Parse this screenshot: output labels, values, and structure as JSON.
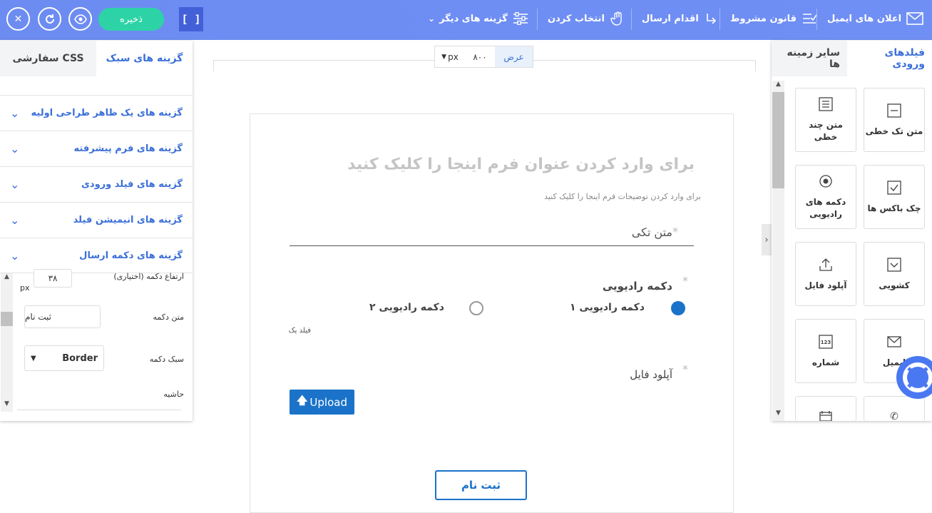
{
  "topbar": {
    "save_label": "ذخیره",
    "bracket_label": "[ ]",
    "items": [
      {
        "label": "اعلان های ایمیل",
        "icon": "mail-icon"
      },
      {
        "label": "قانون مشروط",
        "icon": "condition-icon"
      },
      {
        "label": "اقدام ارسال",
        "icon": "submit-action-icon"
      },
      {
        "label": "انتخاب کردن",
        "icon": "hand-icon"
      },
      {
        "label": "گزینه های دیگر",
        "icon": "sliders-icon"
      }
    ]
  },
  "left_panel": {
    "tabs": [
      {
        "label": "گزینه های سبک"
      },
      {
        "label": "CSS سفارشی"
      }
    ],
    "accordions": [
      {
        "label": "گزینه های یک ظاهر طراحی اولیه"
      },
      {
        "label": "گزینه های فرم پیشرفته"
      },
      {
        "label": "گزینه های فیلد ورودی"
      },
      {
        "label": "گزینه های انیمیشن فیلد"
      },
      {
        "label": "گزینه های دکمه ارسال"
      }
    ],
    "button_height_label": "ارتفاع دکمه (اختیاری)",
    "button_height_value": "۳۸",
    "unit": "px",
    "button_text_label": "متن دکمه",
    "button_text_value": "ثبت نام",
    "button_style_label": "سبک دکمه",
    "button_style_value": "Border",
    "border_label": "حاشیه"
  },
  "canvas": {
    "width_label": "عرض",
    "width_value": "۸۰۰",
    "width_unit": "px"
  },
  "form": {
    "title": "برای وارد کردن عنوان فرم اینجا را کلیک کنید",
    "description": "برای وارد کردن توضیحات فرم اینجا را کلیک کنید",
    "field_single_text": "متن تکی",
    "radio_label": "دکمه رادیویی",
    "radio_options": [
      "دکمه رادیویی ۱",
      "دکمه رادیویی ۲"
    ],
    "radio_hint": "فیلد یک",
    "upload_label": "آپلود فایل",
    "upload_button": "Upload",
    "submit_button": "ثبت نام",
    "required_mark": "*"
  },
  "right_panel": {
    "tabs": [
      {
        "label": "فیلدهای ورودی"
      },
      {
        "label": "سایر زمینه ها"
      }
    ],
    "cards": [
      {
        "label": "متن تک خطی",
        "icon": "single-line-icon"
      },
      {
        "label": "متن چند خطی",
        "icon": "multi-line-icon"
      },
      {
        "label": "چک باکس ها",
        "icon": "checkbox-icon"
      },
      {
        "label": "دکمه های رادیویی",
        "icon": "radio-icon"
      },
      {
        "label": "کشویی",
        "icon": "dropdown-icon"
      },
      {
        "label": "آپلود فایل",
        "icon": "upload-icon"
      },
      {
        "label": "ایمیل",
        "icon": "envelope-icon"
      },
      {
        "label": "شماره",
        "icon": "number-icon"
      },
      {
        "label": "",
        "icon": "phone-icon"
      },
      {
        "label": "",
        "icon": "calendar-icon"
      }
    ]
  },
  "colors": {
    "topbar": "#6d8cf2",
    "save": "#2dd3a6",
    "accent": "#3a6fd8",
    "primary_button": "#1a73c9"
  }
}
